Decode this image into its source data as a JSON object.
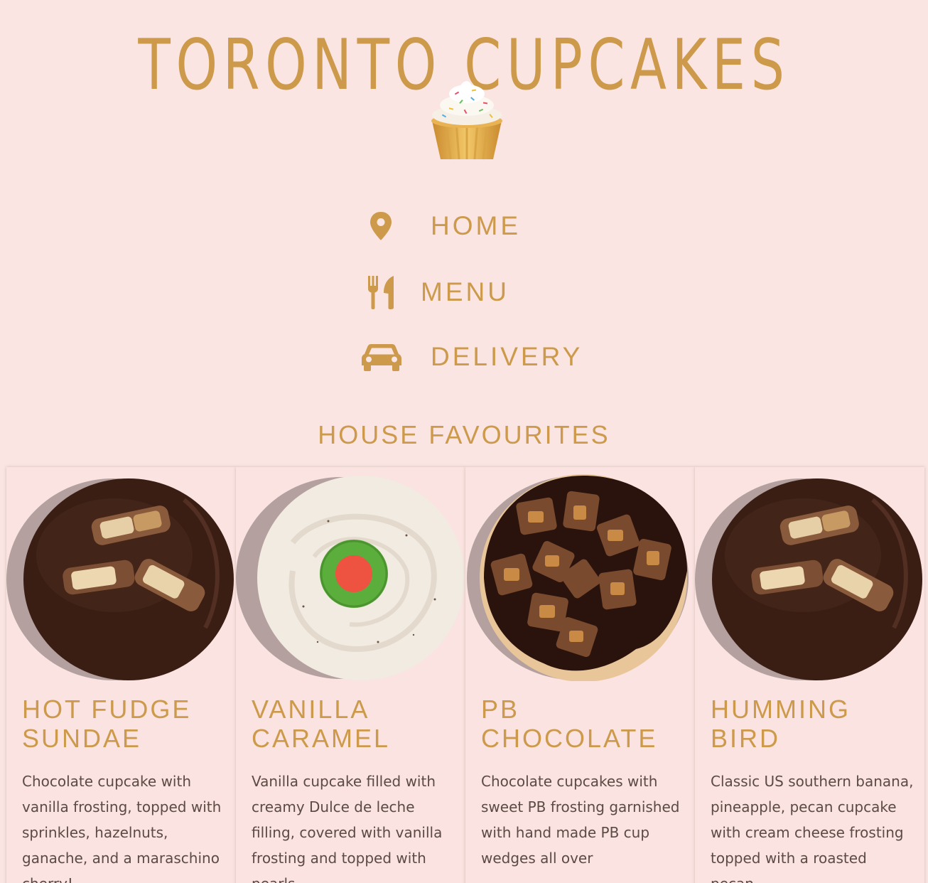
{
  "header": {
    "title": "TORONTO CUPCAKES",
    "logo_icon": "cupcake-icon"
  },
  "nav": {
    "items": [
      {
        "label": "HOME",
        "icon": "map-pin-icon"
      },
      {
        "label": "MENU",
        "icon": "utensils-icon"
      },
      {
        "label": "DELIVERY",
        "icon": "car-icon"
      }
    ]
  },
  "favourites": {
    "heading": "HOUSE FAVOURITES",
    "cards": [
      {
        "title": "HOT FUDGE SUNDAE",
        "description": "Chocolate cupcake with vanilla frosting, topped with sprinkles, hazelnuts, ganache, and a maraschino cherry!"
      },
      {
        "title": "VANILLA CARAMEL",
        "description": "Vanilla cupcake filled with creamy Dulce de leche filling, covered with vanilla frosting and topped with pearls."
      },
      {
        "title": "PB CHOCOLATE",
        "description": "Chocolate cupcakes with sweet PB frosting garnished with hand made PB cup wedges all over"
      },
      {
        "title": "HUMMING BIRD",
        "description": "Classic US southern banana, pineapple, pecan cupcake with cream cheese frosting topped with a roasted pecan."
      }
    ]
  },
  "colors": {
    "background": "#fae5e3",
    "accent_gold": "#cc9a4a",
    "body_text": "#5c4a44"
  }
}
